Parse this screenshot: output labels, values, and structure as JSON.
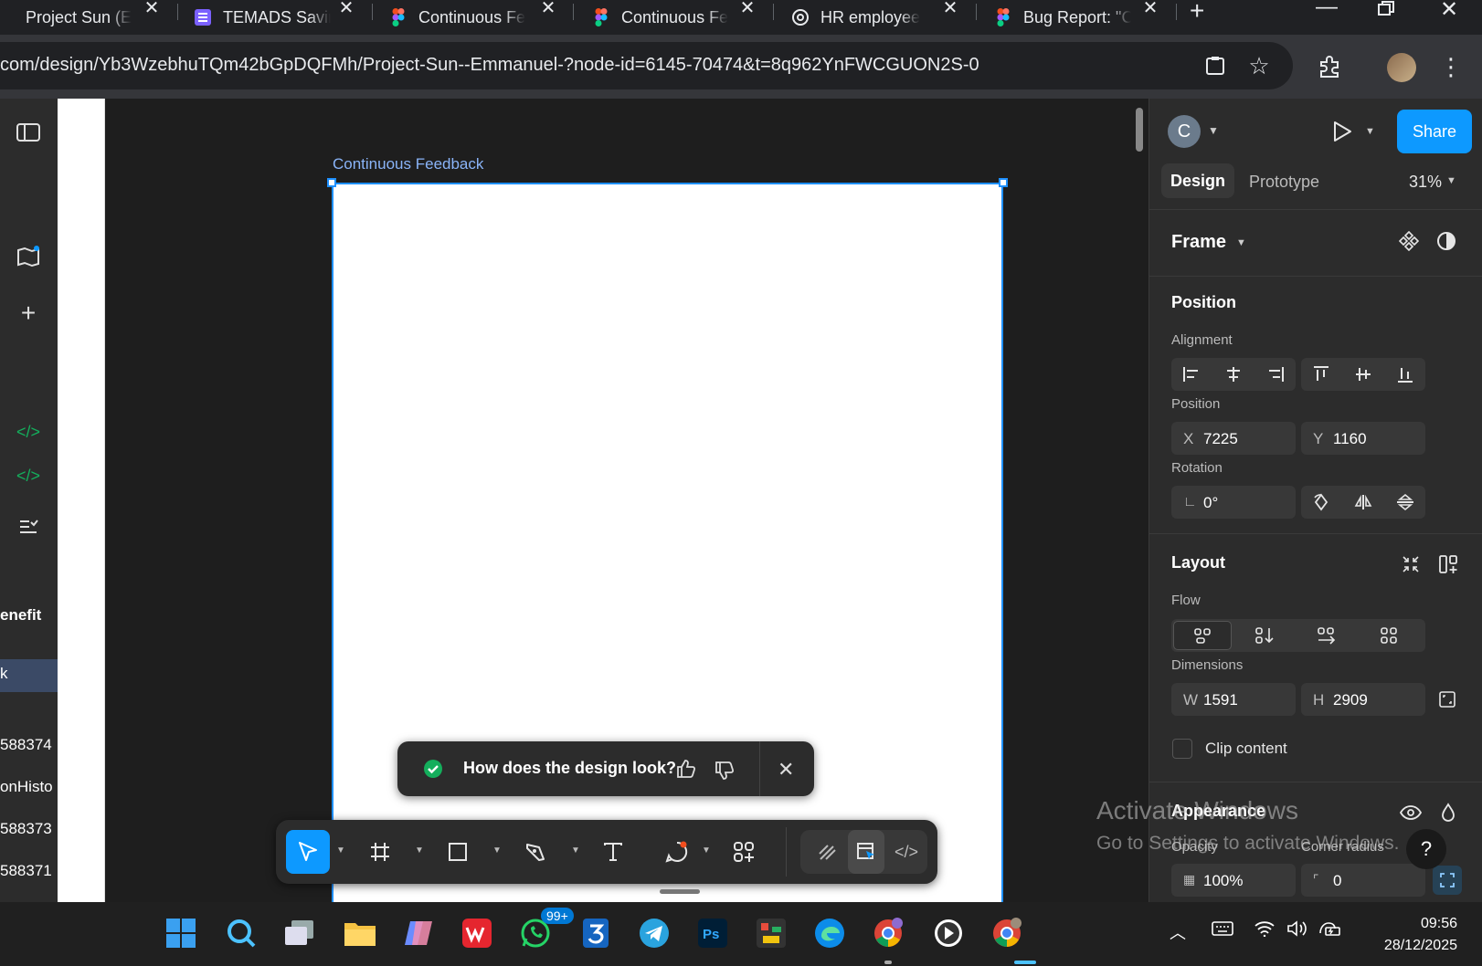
{
  "browser": {
    "tabs": [
      {
        "label": "Project Sun (E",
        "icon": "figma-icon"
      },
      {
        "label": "TEMADS Savir",
        "icon": "forms-icon"
      },
      {
        "label": "Continuous Fe",
        "icon": "figma-icon"
      },
      {
        "label": "Continuous Fe",
        "icon": "figma-icon"
      },
      {
        "label": "HR employee",
        "icon": "chatgpt-icon"
      },
      {
        "label": "Bug Report: \"C",
        "icon": "figma-icon"
      }
    ],
    "url": "com/design/Yb3WzebhuTQm42bGpDQFMh/Project-Sun--Emmanuel-?node-id=6145-70474&t=8q962YnFWCGUON2S-0"
  },
  "left_rail": {
    "layer_items": [
      "k",
      "enefit",
      "588374",
      "onHisto",
      "588373",
      "588371"
    ]
  },
  "canvas": {
    "frame_label": "Continuous Feedback"
  },
  "toast": {
    "question": "How does the design look?"
  },
  "right_panel": {
    "avatar_letter": "C",
    "share_label": "Share",
    "tabs": {
      "design": "Design",
      "prototype": "Prototype"
    },
    "zoom": "31%",
    "frame_label": "Frame",
    "position_section": "Position",
    "alignment_label": "Alignment",
    "position_label": "Position",
    "x_label": "X",
    "x_value": "7225",
    "y_label": "Y",
    "y_value": "1160",
    "rotation_label": "Rotation",
    "rotation_value": "0°",
    "layout_section": "Layout",
    "flow_label": "Flow",
    "dimensions_label": "Dimensions",
    "w_label": "W",
    "w_value": "1591",
    "h_label": "H",
    "h_value": "2909",
    "clip_content_label": "Clip content",
    "appearance_section": "Appearance",
    "opacity_label": "Opacity",
    "opacity_value": "100%",
    "corner_radius_label": "Corner radius",
    "corner_radius_value": "0"
  },
  "watermark": {
    "line1": "Activate Windows",
    "line2": "Go to Settings to activate Windows."
  },
  "help": "?",
  "taskbar": {
    "whatsapp_badge": "99+",
    "time": "09:56",
    "date": "28/12/2025"
  },
  "colors": {
    "accent": "#0d99ff",
    "selection": "#1e90ff",
    "panel": "#2c2c2c",
    "canvas": "#1e1e1e"
  }
}
